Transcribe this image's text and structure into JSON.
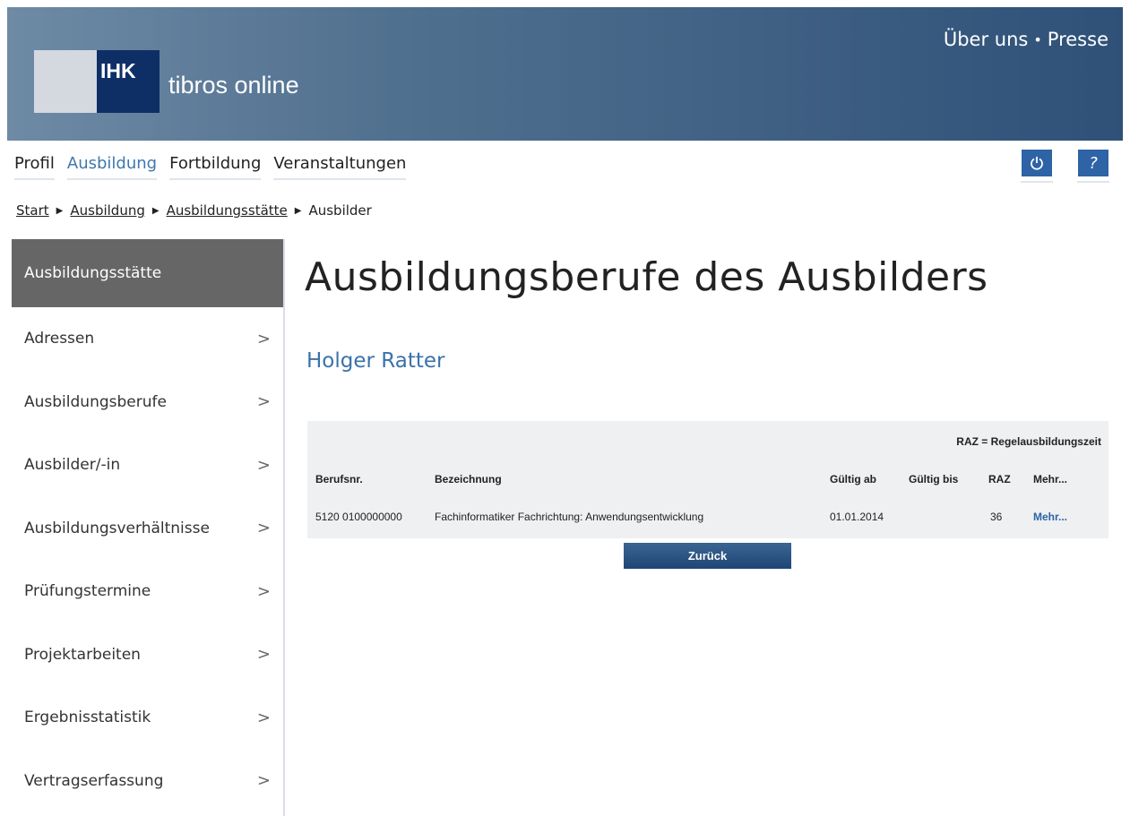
{
  "header": {
    "logo_mark": "IHK",
    "logo_text": "tibros online",
    "links": [
      "Über uns",
      "Presse"
    ],
    "link_separator": "•"
  },
  "mainnav": {
    "items": [
      {
        "label": "Profil",
        "active": false
      },
      {
        "label": "Ausbildung",
        "active": true
      },
      {
        "label": "Fortbildung",
        "active": false
      },
      {
        "label": "Veranstaltungen",
        "active": false
      }
    ],
    "icons": {
      "power": "power-icon",
      "help": "help-icon"
    },
    "help_glyph": "?"
  },
  "breadcrumb": {
    "items": [
      "Start",
      "Ausbildung",
      "Ausbildungsstätte",
      "Ausbilder"
    ]
  },
  "sidebar": {
    "heading": "Ausbildungsstätte",
    "items": [
      "Adressen",
      "Ausbildungsberufe",
      "Ausbilder/-in",
      "Ausbildungsverhältnisse",
      "Prüfungstermine",
      "Projektarbeiten",
      "Ergebnisstatistik",
      "Vertragserfassung"
    ],
    "chevron": ">"
  },
  "main": {
    "title": "Ausbildungsberufe des Ausbilders",
    "subtitle": "Holger Ratter",
    "raz_note": "RAZ = Regelausbildungszeit",
    "table": {
      "headers": [
        "Berufsnr.",
        "Bezeichnung",
        "Gültig ab",
        "Gültig bis",
        "RAZ",
        "Mehr..."
      ],
      "rows": [
        [
          "5120 0100000000",
          "Fachinformatiker Fachrichtung: Anwendungsentwicklung",
          "01.01.2014",
          "",
          "36",
          "Mehr..."
        ]
      ]
    },
    "back_button": "Zurück"
  },
  "colors": {
    "header_gradient_start": "#6e8aa5",
    "header_gradient_end": "#2f5178",
    "logo_dark": "#0e2f66",
    "accent_blue": "#3a72aa",
    "sidebar_active": "#666666",
    "table_bg": "#eef0f2",
    "button_blue": "#1f4674"
  }
}
